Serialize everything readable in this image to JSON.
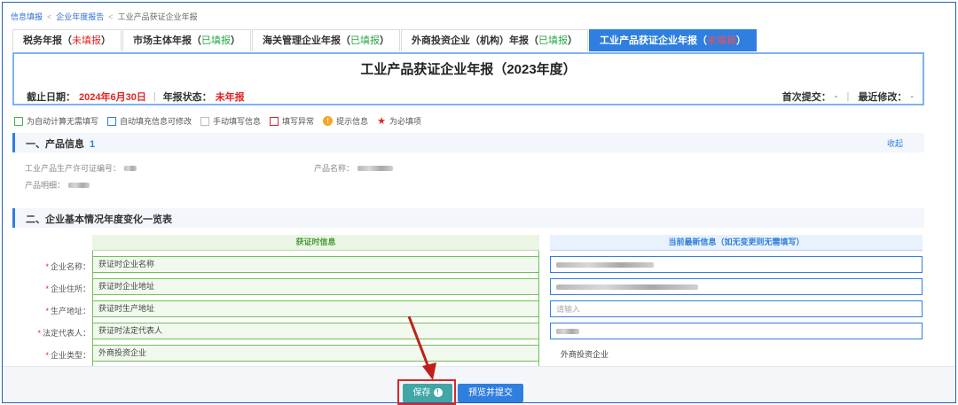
{
  "breadcrumb": [
    "信息填报",
    "企业年度报告",
    "工业产品获证企业年报"
  ],
  "tabs": [
    {
      "name": "税务年报",
      "status": "未填报",
      "status_color": "red"
    },
    {
      "name": "市场主体年报",
      "status": "已填报",
      "status_color": "green"
    },
    {
      "name": "海关管理企业年报",
      "status": "已填报",
      "status_color": "green"
    },
    {
      "name": "外商投资企业（机构）年报",
      "status": "已填报",
      "status_color": "green"
    },
    {
      "name": "工业产品获证企业年报",
      "status": "未填报",
      "status_color": "red",
      "active": true
    }
  ],
  "report": {
    "title": "工业产品获证企业年报（2023年度）",
    "deadline_label": "截止日期：",
    "deadline_value": "2024年6月30日",
    "status_label": "年报状态：",
    "status_value": "未年报",
    "first_submit_label": "首次提交：",
    "first_submit_value": "-",
    "last_modified_label": "最近修改：",
    "last_modified_value": "-"
  },
  "legend": {
    "auto_calc": "为自动计算无需填写",
    "auto_fill": "自动填充信息可修改",
    "manual": "手动填写信息",
    "error": "填写异常",
    "hint": "提示信息",
    "required": "为必填项"
  },
  "section1": {
    "title": "一、产品信息",
    "count": "1",
    "collapse": "收起",
    "license_label": "工业产品生产许可证编号：",
    "product_name_label": "产品名称：",
    "product_detail_label": "产品明细："
  },
  "section2": {
    "title": "二、企业基本情况年度变化一览表",
    "col_left": "获证时信息",
    "col_right": "当前最新信息（如无变更则无需填写）",
    "rows": [
      {
        "label": "企业名称：",
        "left": "获证时企业名称",
        "right_placeholder": ""
      },
      {
        "label": "企业住所：",
        "left": "获证时企业地址",
        "right_placeholder": ""
      },
      {
        "label": "生产地址：",
        "left": "获证时生产地址",
        "right_placeholder": "请输入"
      },
      {
        "label": "法定代表人：",
        "left": "获证时法定代表人",
        "right_placeholder": ""
      },
      {
        "label": "企业类型：",
        "left": "外商投资企业",
        "right_value": "外商投资企业"
      }
    ]
  },
  "footer": {
    "save_label": "保存",
    "preview_submit_label": "预览并提交"
  },
  "colors": {
    "primary": "#2f7fe0",
    "save": "#41a6a6",
    "highlight": "#e02424",
    "green": "#6fc15a"
  }
}
